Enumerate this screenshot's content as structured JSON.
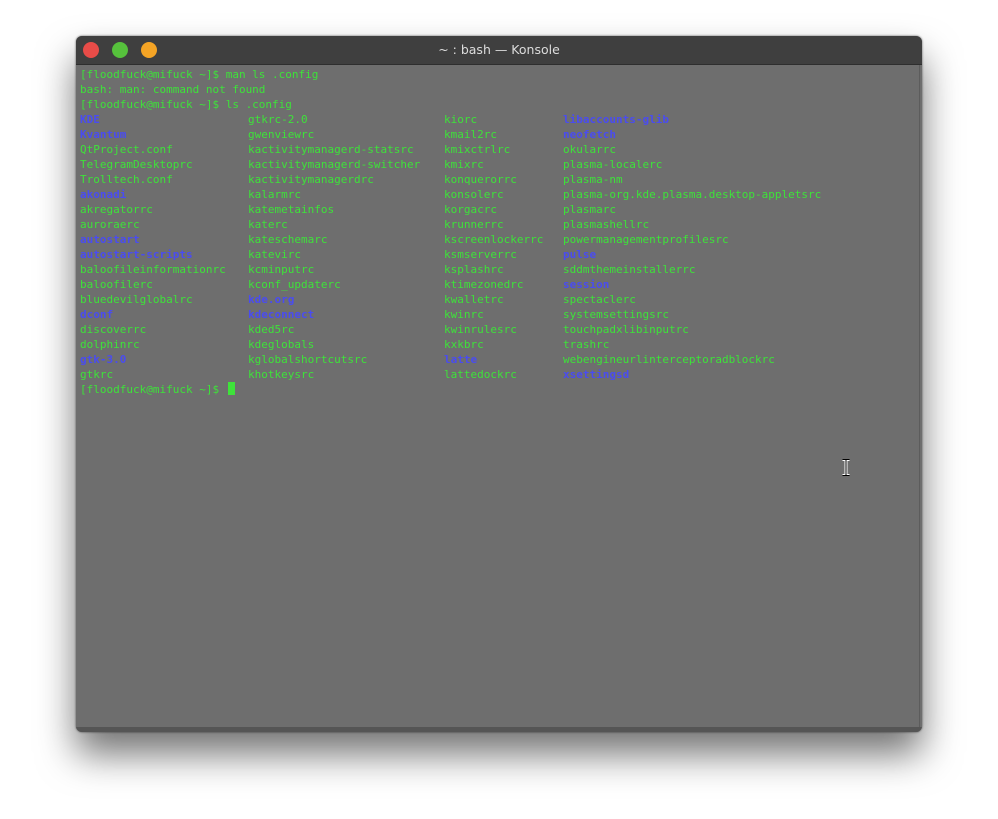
{
  "window": {
    "title": "~ : bash — Konsole"
  },
  "terminal": {
    "lines": [
      "[floodfuck@mifuck ~]$ man ls .config",
      "bash: man: command not found",
      "[floodfuck@mifuck ~]$ ls .config"
    ],
    "prompt": "[floodfuck@mifuck ~]$ ",
    "columns": [
      [
        {
          "name": "KDE",
          "dir": true
        },
        {
          "name": "Kvantum",
          "dir": true
        },
        {
          "name": "QtProject.conf",
          "dir": false
        },
        {
          "name": "TelegramDesktoprc",
          "dir": false
        },
        {
          "name": "Trolltech.conf",
          "dir": false
        },
        {
          "name": "akonadi",
          "dir": true
        },
        {
          "name": "akregatorrc",
          "dir": false
        },
        {
          "name": "auroraerc",
          "dir": false
        },
        {
          "name": "autostart",
          "dir": true
        },
        {
          "name": "autostart-scripts",
          "dir": true
        },
        {
          "name": "baloofileinformationrc",
          "dir": false
        },
        {
          "name": "baloofilerc",
          "dir": false
        },
        {
          "name": "bluedevilglobalrc",
          "dir": false
        },
        {
          "name": "dconf",
          "dir": true
        },
        {
          "name": "discoverrc",
          "dir": false
        },
        {
          "name": "dolphinrc",
          "dir": false
        },
        {
          "name": "gtk-3.0",
          "dir": true
        },
        {
          "name": "gtkrc",
          "dir": false
        }
      ],
      [
        {
          "name": "gtkrc-2.0",
          "dir": false
        },
        {
          "name": "gwenviewrc",
          "dir": false
        },
        {
          "name": "kactivitymanagerd-statsrc",
          "dir": false
        },
        {
          "name": "kactivitymanagerd-switcher",
          "dir": false
        },
        {
          "name": "kactivitymanagerdrc",
          "dir": false
        },
        {
          "name": "kalarmrc",
          "dir": false
        },
        {
          "name": "katemetainfos",
          "dir": false
        },
        {
          "name": "katerc",
          "dir": false
        },
        {
          "name": "kateschemarc",
          "dir": false
        },
        {
          "name": "katevirc",
          "dir": false
        },
        {
          "name": "kcminputrc",
          "dir": false
        },
        {
          "name": "kconf_updaterc",
          "dir": false
        },
        {
          "name": "kde.org",
          "dir": true
        },
        {
          "name": "kdeconnect",
          "dir": true
        },
        {
          "name": "kded5rc",
          "dir": false
        },
        {
          "name": "kdeglobals",
          "dir": false
        },
        {
          "name": "kglobalshortcutsrc",
          "dir": false
        },
        {
          "name": "khotkeysrc",
          "dir": false
        }
      ],
      [
        {
          "name": "kiorc",
          "dir": false
        },
        {
          "name": "kmail2rc",
          "dir": false
        },
        {
          "name": "kmixctrlrc",
          "dir": false
        },
        {
          "name": "kmixrc",
          "dir": false
        },
        {
          "name": "konquerorrc",
          "dir": false
        },
        {
          "name": "konsolerc",
          "dir": false
        },
        {
          "name": "korgacrc",
          "dir": false
        },
        {
          "name": "krunnerrc",
          "dir": false
        },
        {
          "name": "kscreenlockerrc",
          "dir": false
        },
        {
          "name": "ksmserverrc",
          "dir": false
        },
        {
          "name": "ksplashrc",
          "dir": false
        },
        {
          "name": "ktimezonedrc",
          "dir": false
        },
        {
          "name": "kwalletrc",
          "dir": false
        },
        {
          "name": "kwinrc",
          "dir": false
        },
        {
          "name": "kwinrulesrc",
          "dir": false
        },
        {
          "name": "kxkbrc",
          "dir": false
        },
        {
          "name": "latte",
          "dir": true
        },
        {
          "name": "lattedockrc",
          "dir": false
        }
      ],
      [
        {
          "name": "libaccounts-glib",
          "dir": true
        },
        {
          "name": "neofetch",
          "dir": true
        },
        {
          "name": "okularrc",
          "dir": false
        },
        {
          "name": "plasma-localerc",
          "dir": false
        },
        {
          "name": "plasma-nm",
          "dir": false
        },
        {
          "name": "plasma-org.kde.plasma.desktop-appletsrc",
          "dir": false
        },
        {
          "name": "plasmarc",
          "dir": false
        },
        {
          "name": "plasmashellrc",
          "dir": false
        },
        {
          "name": "powermanagementprofilesrc",
          "dir": false
        },
        {
          "name": "pulse",
          "dir": true
        },
        {
          "name": "sddmthemeinstallerrc",
          "dir": false
        },
        {
          "name": "session",
          "dir": true
        },
        {
          "name": "spectaclerc",
          "dir": false
        },
        {
          "name": "systemsettingsrc",
          "dir": false
        },
        {
          "name": "touchpadxlibinputrc",
          "dir": false
        },
        {
          "name": "trashrc",
          "dir": false
        },
        {
          "name": "webengineurlinterceptoradblockrc",
          "dir": false
        },
        {
          "name": "xsettingsd",
          "dir": true
        }
      ]
    ],
    "colors": {
      "file": "#3ee23a",
      "directory": "#4a4cf0",
      "background": "#6e6e6e"
    }
  }
}
